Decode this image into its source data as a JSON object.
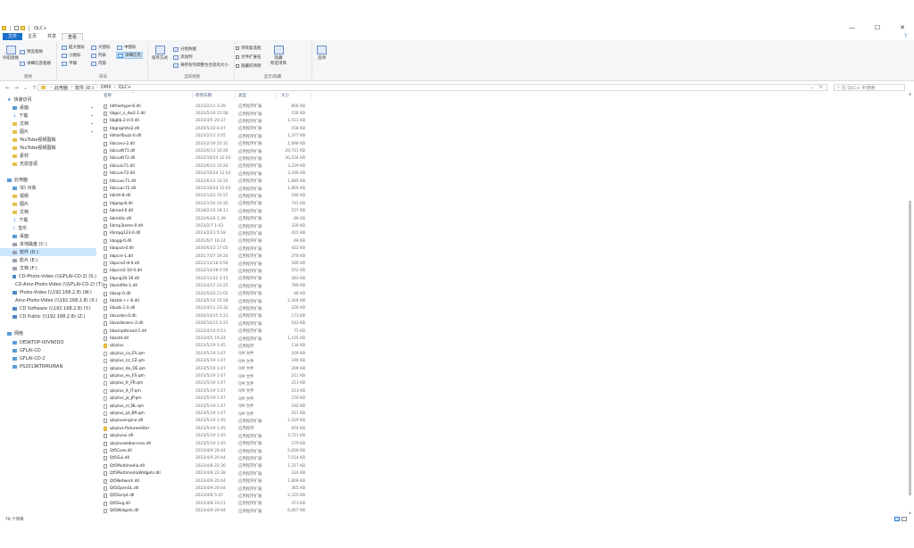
{
  "titlebar": {
    "title": "QLC+"
  },
  "window_controls": {
    "min": "—",
    "max": "☐",
    "close": "✕"
  },
  "ribbon_tabs": [
    "文件",
    "主页",
    "共享",
    "查看"
  ],
  "ribbon": {
    "pane": {
      "nav_pane": "导航窗格",
      "preview": "预览窗格",
      "details": "详细信息窗格",
      "label": "窗格"
    },
    "layout": {
      "xl_icons": "超大图标",
      "l_icons": "大图标",
      "m_icons": "中图标",
      "s_icons": "小图标",
      "list": "列表",
      "details": "详细信息",
      "tiles": "平铺",
      "content": "内容",
      "label": "布局"
    },
    "current_view": {
      "sort_by": "排序方式",
      "group_by": "分组依据",
      "add_cols": "添加列",
      "fit_cols": "将所有列调整为合适的大小",
      "label": "当前视图"
    },
    "show_hide": {
      "item_checkboxes": "项目复选框",
      "file_ext": "文件扩展名",
      "hidden_items": "隐藏的项目",
      "hide_selected": "隐藏\n所选项目",
      "options": "选项",
      "label": "显示/隐藏"
    }
  },
  "address": {
    "crumbs": [
      "此电脑",
      "软件 (D:)",
      "DMX",
      "QLC+"
    ],
    "search_placeholder": "在 QLC+ 中搜索"
  },
  "nav": [
    {
      "label": "快速访问",
      "icon": "star-icon",
      "kind": "star"
    },
    {
      "label": "桌面",
      "icon": "folder-icon",
      "kind": "pc",
      "pin": true
    },
    {
      "label": "下载",
      "icon": "download-icon",
      "kind": "dl",
      "pin": true
    },
    {
      "label": "文档",
      "icon": "folder-icon",
      "kind": "folder",
      "pin": true
    },
    {
      "label": "图片",
      "icon": "folder-icon",
      "kind": "folder",
      "pin": true
    },
    {
      "label": "YouTube视频图稿",
      "icon": "folder-icon",
      "kind": "folder"
    },
    {
      "label": "YouTube视频图稿",
      "icon": "folder-icon",
      "kind": "folder"
    },
    {
      "label": "素材",
      "icon": "folder-icon",
      "kind": "folder"
    },
    {
      "label": "无损音源",
      "icon": "folder-icon",
      "kind": "folder"
    },
    {
      "label": "此电脑",
      "icon": "pc-icon",
      "kind": "pc"
    },
    {
      "label": "3D 对象",
      "icon": "folder-icon",
      "kind": "pc"
    },
    {
      "label": "视频",
      "icon": "folder-icon",
      "kind": "folder"
    },
    {
      "label": "图片",
      "icon": "folder-icon",
      "kind": "folder"
    },
    {
      "label": "文档",
      "icon": "folder-icon",
      "kind": "folder"
    },
    {
      "label": "下载",
      "icon": "download-icon",
      "kind": "dl"
    },
    {
      "label": "音乐",
      "icon": "music-icon",
      "kind": "music"
    },
    {
      "label": "桌面",
      "icon": "folder-icon",
      "kind": "pc"
    },
    {
      "label": "本地磁盘 (C:)",
      "icon": "drive-icon",
      "kind": "drive"
    },
    {
      "label": "软件 (D:)",
      "icon": "drive-icon",
      "kind": "drive",
      "selected": true
    },
    {
      "label": "影片 (E:)",
      "icon": "drive-icon",
      "kind": "drive"
    },
    {
      "label": "文档 (F:)",
      "icon": "drive-icon",
      "kind": "drive"
    },
    {
      "label": "CD-Photo-Video (\\\\GFLAI-CD-2) (S:)",
      "icon": "network-drive-icon",
      "kind": "net"
    },
    {
      "label": "CD-Amz-Photo-Video (\\\\GFLAI-CD-2) (T:)",
      "icon": "network-drive-icon",
      "kind": "net"
    },
    {
      "label": "Photo-Video (\\\\192.168.2.8) (W:)",
      "icon": "network-drive-icon",
      "kind": "net"
    },
    {
      "label": "Amz-Photo-Video (\\\\192.168.2.8) (X:)",
      "icon": "network-drive-icon",
      "kind": "net"
    },
    {
      "label": "CD Software (\\\\192.168.2.8) (Y:)",
      "icon": "network-drive-icon",
      "kind": "net"
    },
    {
      "label": "CD Public (\\\\192.168.2.8) (Z:)",
      "icon": "network-drive-icon",
      "kind": "net"
    },
    {
      "label": "网络",
      "icon": "network-icon",
      "kind": "pc"
    },
    {
      "label": "DESKTOP-00VN0DO",
      "icon": "computer-icon",
      "kind": "pc"
    },
    {
      "label": "GFLAI-CD",
      "icon": "computer-icon",
      "kind": "pc"
    },
    {
      "label": "GFLAI-CD-2",
      "icon": "computer-icon",
      "kind": "pc"
    },
    {
      "label": "PS2019KTRMUIRAN",
      "icon": "computer-icon",
      "kind": "pc"
    }
  ],
  "columns": {
    "name": "名称",
    "date": "修改日期",
    "type": "类型",
    "size": "大小"
  },
  "files": [
    {
      "name": "libfreetype-6.dll",
      "date": "2023/2/11 3:39",
      "type": "应用程序扩展",
      "size": "806 KB",
      "kind": "dll"
    },
    {
      "name": "libgcc_s_dw2-1.dll",
      "date": "2023/5/10 15:58",
      "type": "应用程序扩展",
      "size": "156 KB",
      "kind": "dll"
    },
    {
      "name": "libglib-2.0-0.dll",
      "date": "2023/3/5 20:37",
      "type": "应用程序扩展",
      "size": "1,511 KB",
      "kind": "dll"
    },
    {
      "name": "libgraphite2.dll",
      "date": "2020/5/10 8:47",
      "type": "应用程序扩展",
      "size": "158 KB",
      "kind": "dll"
    },
    {
      "name": "libharfbuzz-0.dll",
      "date": "2023/2/11 3:05",
      "type": "应用程序扩展",
      "size": "1,377 KB",
      "kind": "dll"
    },
    {
      "name": "libiconv-2.dll",
      "date": "2022/2/19 20:31",
      "type": "应用程序扩展",
      "size": "1,098 KB",
      "kind": "dll"
    },
    {
      "name": "libicudt71.dll",
      "date": "2022/6/13 10:20",
      "type": "应用程序扩展",
      "size": "29,721 KB",
      "kind": "dll"
    },
    {
      "name": "libicudt72.dll",
      "date": "2022/10/24 12:43",
      "type": "应用程序扩展",
      "size": "30,534 KB",
      "kind": "dll"
    },
    {
      "name": "libicuin71.dll",
      "date": "2022/6/13 10:20",
      "type": "应用程序扩展",
      "size": "3,229 KB",
      "kind": "dll"
    },
    {
      "name": "libicuin72.dll",
      "date": "2022/10/24 12:43",
      "type": "应用程序扩展",
      "size": "3,346 KB",
      "kind": "dll"
    },
    {
      "name": "libicuuc71.dll",
      "date": "2022/6/13 10:20",
      "type": "应用程序扩展",
      "size": "1,885 KB",
      "kind": "dll"
    },
    {
      "name": "libicuuc72.dll",
      "date": "2022/10/24 12:43",
      "type": "应用程序扩展",
      "size": "1,905 KB",
      "kind": "dll"
    },
    {
      "name": "libintl-8.dll",
      "date": "2022/1/23 15:57",
      "type": "应用程序扩展",
      "size": "180 KB",
      "kind": "dll"
    },
    {
      "name": "libjpeg-8.dll",
      "date": "2022/1/16 20:32",
      "type": "应用程序扩展",
      "size": "741 KB",
      "kind": "dll"
    },
    {
      "name": "libmad-0.dll",
      "date": "2018/2/15 18:11",
      "type": "应用程序扩展",
      "size": "157 KB",
      "kind": "dll"
    },
    {
      "name": "libmd4c.dll",
      "date": "2022/6/28 1:39",
      "type": "应用程序扩展",
      "size": "86 KB",
      "kind": "dll"
    },
    {
      "name": "libmp3lame-0.dll",
      "date": "2023/2/7 1:43",
      "type": "应用程序扩展",
      "size": "330 KB",
      "kind": "dll"
    },
    {
      "name": "libmpg123-0.dll",
      "date": "2023/2/21 5:18",
      "type": "应用程序扩展",
      "size": "415 KB",
      "kind": "dll"
    },
    {
      "name": "libogg-0.dll",
      "date": "2021/6/7 16:24",
      "type": "应用程序扩展",
      "size": "69 KB",
      "kind": "dll"
    },
    {
      "name": "libopus-0.dll",
      "date": "2020/6/23 17:05",
      "type": "应用程序扩展",
      "size": "422 KB",
      "kind": "dll"
    },
    {
      "name": "libpcre-1.dll",
      "date": "2021/7/27 19:24",
      "type": "应用程序扩展",
      "size": "278 KB",
      "kind": "dll"
    },
    {
      "name": "libpcre2-8-0.dll",
      "date": "2022/12/18 0:59",
      "type": "应用程序扩展",
      "size": "580 KB",
      "kind": "dll"
    },
    {
      "name": "libpcre2-16-0.dll",
      "date": "2022/12/18 0:59",
      "type": "应用程序扩展",
      "size": "552 KB",
      "kind": "dll"
    },
    {
      "name": "libpng16-16.dll",
      "date": "2022/11/22 3:15",
      "type": "应用程序扩展",
      "size": "283 KB",
      "kind": "dll"
    },
    {
      "name": "libsndfile-1.dll",
      "date": "2023/4/17 23:25",
      "type": "应用程序扩展",
      "size": "789 KB",
      "kind": "dll"
    },
    {
      "name": "libssp-0.dll",
      "date": "2022/5/20 21:02",
      "type": "应用程序扩展",
      "size": "48 KB",
      "kind": "dll"
    },
    {
      "name": "libstdc++-6.dll",
      "date": "2023/5/10 15:58",
      "type": "应用程序扩展",
      "size": "2,404 KB",
      "kind": "dll"
    },
    {
      "name": "libusb-1.0.dll",
      "date": "2022/4/11 23:32",
      "type": "应用程序扩展",
      "size": "226 KB",
      "kind": "dll"
    },
    {
      "name": "libvorbis-0.dll",
      "date": "2020/10/15 5:23",
      "type": "应用程序扩展",
      "size": "173 KB",
      "kind": "dll"
    },
    {
      "name": "libvorbisenc-2.dll",
      "date": "2020/10/15 5:23",
      "type": "应用程序扩展",
      "size": "543 KB",
      "kind": "dll"
    },
    {
      "name": "libwinpthread-1.dll",
      "date": "2022/4/10 0:53",
      "type": "应用程序扩展",
      "size": "71 KB",
      "kind": "dll"
    },
    {
      "name": "libzstd.dll",
      "date": "2023/4/5 19:24",
      "type": "应用程序扩展",
      "size": "1,155 KB",
      "kind": "dll"
    },
    {
      "name": "qlcplus",
      "date": "2023/5/19 1:45",
      "type": "应用程序",
      "size": "134 KB",
      "kind": "app"
    },
    {
      "name": "qlcplus_ca_ES.qm",
      "date": "2023/5/19 1:47",
      "type": "QM 文件",
      "size": "209 KB",
      "kind": "qm"
    },
    {
      "name": "qlcplus_cz_CZ.qm",
      "date": "2023/5/19 1:47",
      "type": "QM 文件",
      "size": "194 KB",
      "kind": "qm"
    },
    {
      "name": "qlcplus_de_DE.qm",
      "date": "2023/5/19 1:47",
      "type": "QM 文件",
      "size": "209 KB",
      "kind": "qm"
    },
    {
      "name": "qlcplus_es_ES.qm",
      "date": "2023/5/19 1:47",
      "type": "QM 文件",
      "size": "211 KB",
      "kind": "qm"
    },
    {
      "name": "qlcplus_fr_FR.qm",
      "date": "2023/5/19 1:47",
      "type": "QM 文件",
      "size": "213 KB",
      "kind": "qm"
    },
    {
      "name": "qlcplus_it_IT.qm",
      "date": "2023/5/19 1:47",
      "type": "QM 文件",
      "size": "213 KB",
      "kind": "qm"
    },
    {
      "name": "qlcplus_ja_JP.qm",
      "date": "2023/5/19 1:47",
      "type": "QM 文件",
      "size": "150 KB",
      "kind": "qm"
    },
    {
      "name": "qlcplus_nl_NL.qm",
      "date": "2023/5/19 1:47",
      "type": "QM 文件",
      "size": "192 KB",
      "kind": "qm"
    },
    {
      "name": "qlcplus_pt_BR.qm",
      "date": "2023/5/19 1:47",
      "type": "QM 文件",
      "size": "211 KB",
      "kind": "qm"
    },
    {
      "name": "qlcplusengine.dll",
      "date": "2023/5/19 1:45",
      "type": "应用程序扩展",
      "size": "1,029 KB",
      "kind": "dll"
    },
    {
      "name": "qlcplus-fixtureeditor",
      "date": "2023/5/19 1:45",
      "type": "应用程序",
      "size": "654 KB",
      "kind": "app"
    },
    {
      "name": "qlcplusui.dll",
      "date": "2023/5/19 1:45",
      "type": "应用程序扩展",
      "size": "3,711 KB",
      "kind": "dll"
    },
    {
      "name": "qlcpluswebaccess.dll",
      "date": "2023/5/19 1:45",
      "type": "应用程序扩展",
      "size": "279 KB",
      "kind": "dll"
    },
    {
      "name": "Qt5Core.dll",
      "date": "2023/4/9 20:44",
      "type": "应用程序扩展",
      "size": "5,600 KB",
      "kind": "dll"
    },
    {
      "name": "Qt5Gui.dll",
      "date": "2023/4/9 20:44",
      "type": "应用程序扩展",
      "size": "7,514 KB",
      "kind": "dll"
    },
    {
      "name": "Qt5Multimedia.dll",
      "date": "2023/4/8 22:36",
      "type": "应用程序扩展",
      "size": "1,317 KB",
      "kind": "dll"
    },
    {
      "name": "Qt5MultimediaWidgets.dll",
      "date": "2023/4/8 22:38",
      "type": "应用程序扩展",
      "size": "224 KB",
      "kind": "dll"
    },
    {
      "name": "Qt5Network.dll",
      "date": "2023/4/9 20:44",
      "type": "应用程序扩展",
      "size": "1,809 KB",
      "kind": "dll"
    },
    {
      "name": "Qt5OpenGL.dll",
      "date": "2023/4/9 20:44",
      "type": "应用程序扩展",
      "size": "365 KB",
      "kind": "dll"
    },
    {
      "name": "Qt5Script.dll",
      "date": "2023/4/8 5:47",
      "type": "应用程序扩展",
      "size": "2,310 KB",
      "kind": "dll"
    },
    {
      "name": "Qt5Svg.dll",
      "date": "2023/4/8 23:11",
      "type": "应用程序扩展",
      "size": "373 KB",
      "kind": "dll"
    },
    {
      "name": "Qt5Widgets.dll",
      "date": "2023/4/9 20:44",
      "type": "应用程序扩展",
      "size": "6,667 KB",
      "kind": "dll"
    }
  ],
  "status": {
    "count": "78 个项目"
  }
}
